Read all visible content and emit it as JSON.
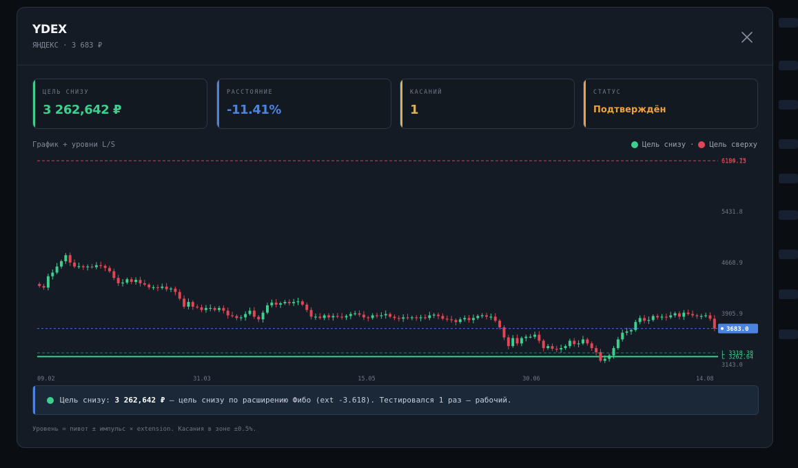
{
  "header": {
    "title": "YDEX",
    "subtitle": "ЯНДЕКС · 3 683 ₽"
  },
  "cards": [
    {
      "label": "ЦЕЛЬ СНИЗУ",
      "value": "3 262,642 ₽",
      "color": "#3ecf8e"
    },
    {
      "label": "РАССТОЯНИЕ",
      "value": "-11.41%",
      "color": "#4a84e0"
    },
    {
      "label": "КАСАНИЙ",
      "value": "1",
      "color": "#d8b35a"
    },
    {
      "label": "СТАТУС",
      "value": "Подтверждён",
      "color": "#f0a23a"
    }
  ],
  "chart_section": {
    "title": "График + уровни L/S",
    "legend": [
      {
        "label": "Цель снизу",
        "color": "#3ecf8e"
      },
      {
        "label": "Цель сверху",
        "color": "#e04656"
      }
    ],
    "legend_separator": "·"
  },
  "chart_data": {
    "type": "candlestick",
    "x_ticks": [
      "09.02",
      "31.03",
      "15.05",
      "30.06",
      "14.08"
    ],
    "y_ticks": [
      "5431.8",
      "4668.9",
      "3905.9",
      "3143.0"
    ],
    "ylim": [
      3143.0,
      6194.75
    ],
    "current_price": {
      "label": "3683.0",
      "value": 3683.0,
      "color": "#4a84e0"
    },
    "levels": [
      {
        "label": "6194.75",
        "value": 6194.75,
        "color": "#e04656",
        "style": "dashed"
      },
      {
        "label": "6189.13",
        "value": 6189.13,
        "color": "#e04656",
        "style": "dashed"
      },
      {
        "label": "L 3318.38",
        "value": 3318.38,
        "color": "#3ecf8e",
        "style": "dashed"
      },
      {
        "label": "L 3262.64",
        "value": 3262.64,
        "color": "#3ecf8e",
        "style": "solid"
      }
    ],
    "colors": {
      "up": "#3ecf8e",
      "down": "#e04656",
      "grid": "#3a4452"
    },
    "close": [
      4320,
      4295,
      4465,
      4520,
      4610,
      4690,
      4780,
      4670,
      4610,
      4615,
      4600,
      4610,
      4600,
      4630,
      4620,
      4590,
      4540,
      4440,
      4360,
      4370,
      4420,
      4380,
      4410,
      4360,
      4340,
      4300,
      4300,
      4290,
      4310,
      4270,
      4280,
      4230,
      4130,
      4010,
      4080,
      4010,
      4000,
      3960,
      3990,
      3990,
      3960,
      3990,
      3950,
      3880,
      3870,
      3840,
      3850,
      3900,
      3950,
      3860,
      3820,
      3920,
      4030,
      4070,
      4040,
      4060,
      4080,
      4060,
      4080,
      4090,
      4040,
      3960,
      3860,
      3860,
      3840,
      3880,
      3850,
      3870,
      3860,
      3850,
      3870,
      3900,
      3910,
      3890,
      3850,
      3840,
      3880,
      3870,
      3880,
      3900,
      3860,
      3840,
      3830,
      3850,
      3840,
      3850,
      3840,
      3850,
      3840,
      3880,
      3890,
      3870,
      3830,
      3820,
      3810,
      3780,
      3820,
      3840,
      3810,
      3840,
      3870,
      3880,
      3860,
      3860,
      3800,
      3700,
      3550,
      3420,
      3540,
      3460,
      3540,
      3560,
      3560,
      3590,
      3500,
      3390,
      3420,
      3380,
      3370,
      3390,
      3420,
      3500,
      3450,
      3460,
      3520,
      3460,
      3390,
      3330,
      3200,
      3230,
      3280,
      3390,
      3520,
      3620,
      3640,
      3660,
      3780,
      3840,
      3800,
      3810,
      3870,
      3850,
      3860,
      3850,
      3880,
      3910,
      3860,
      3920,
      3900,
      3880,
      3870,
      3870,
      3880,
      3830,
      3683
    ]
  },
  "info": {
    "lead": "Цель снизу:",
    "value": "3 262,642 ₽",
    "text": "— цель снизу по расширению Фибо (ext -3.618). Тестировался 1 раз — рабочий."
  },
  "footnote": "Уровень = пивот ± импульс × extension. Касания в зоне ±0.5%."
}
